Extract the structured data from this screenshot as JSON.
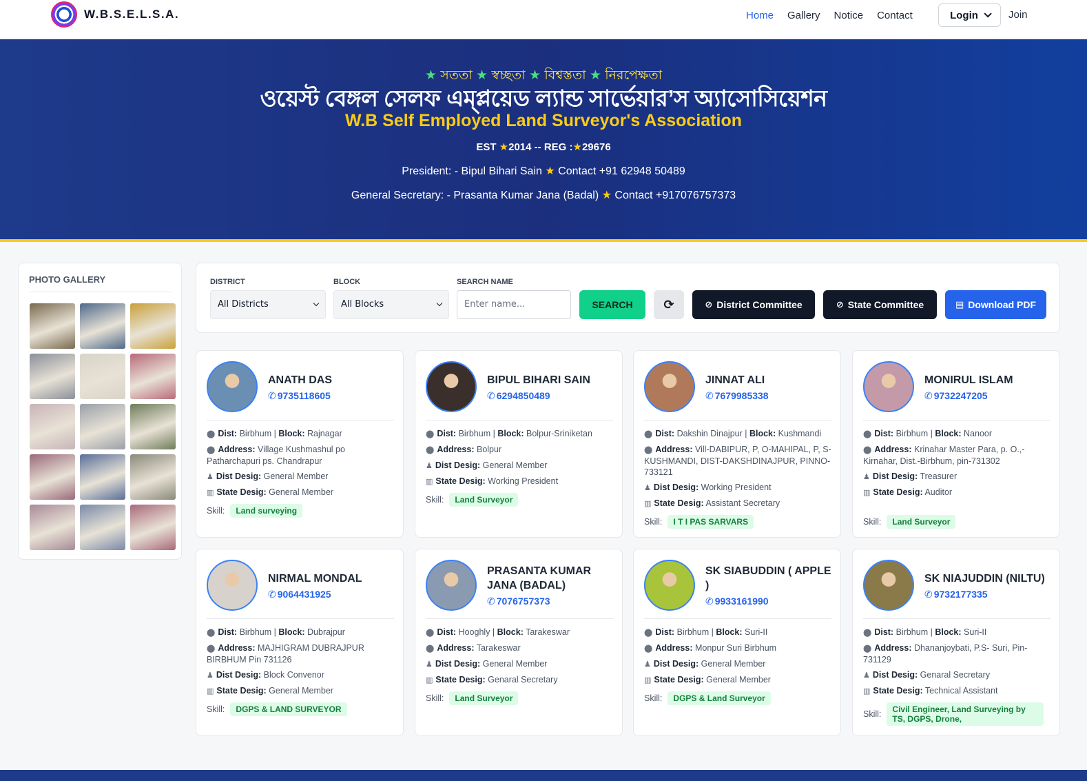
{
  "nav": {
    "brand": "W.B.S.E.L.S.A.",
    "links": [
      "Home",
      "Gallery",
      "Notice",
      "Contact"
    ],
    "login": "Login",
    "join": "Join"
  },
  "hero": {
    "motto_1": "সততা",
    "motto_2": "স্বচ্ছতা",
    "motto_3": "বিশ্বস্ততা",
    "motto_4": "নিরপেক্ষতা",
    "bn_title": "ওয়েস্ট বেঙ্গল সেলফ এম্প্লয়েড ল্যান্ড সার্ভেয়ার’স অ্যাসোসিয়েশন",
    "en_title": "W.B Self Employed Land Surveyor's Association",
    "est_label": "EST",
    "est_year": "2014",
    "reg_label": "-- REG :",
    "reg_no": "29676",
    "president": "President: - Bipul Bihari Sain",
    "president_contact": "Contact +91 62948 50489",
    "gen_sec": "General Secretary: - Prasanta Kumar Jana (Badal)",
    "gen_sec_contact": "Contact +917076757373"
  },
  "gallery": {
    "title": "PHOTO GALLERY",
    "thumb_colors": [
      "#7a6a4f",
      "#4f6a8a",
      "#c9a13a",
      "#8a8f99",
      "#d9d4c8",
      "#b86a7a",
      "#c8b4b8",
      "#9aa0a8",
      "#6f7d5a",
      "#9a6a7a",
      "#5a6f9a",
      "#8a8a7a",
      "#a88a98",
      "#7a8aa8",
      "#a86a7a"
    ]
  },
  "filters": {
    "district_label": "DISTRICT",
    "district_value": "All Districts",
    "block_label": "BLOCK",
    "block_value": "All Blocks",
    "search_label": "SEARCH NAME",
    "search_placeholder": "Enter name...",
    "search_btn": "SEARCH",
    "district_committee": "District Committee",
    "state_committee": "State Committee",
    "download_pdf": "Download PDF"
  },
  "labels": {
    "dist": "Dist:",
    "block": "Block:",
    "address": "Address:",
    "dist_desig": "Dist Desig:",
    "state_desig": "State Desig:",
    "skill": "Skill:"
  },
  "members": [
    {
      "name": "ANATH DAS",
      "phone": "9735118605",
      "dist": "Birbhum",
      "block": "Rajnagar",
      "address": "Village Kushmashul po Patharchapuri ps. Chandrapur",
      "dist_desig": "General Member",
      "state_desig": "General Member",
      "skill": "Land surveying",
      "avatar_color": "#6b8fb3"
    },
    {
      "name": "BIPUL BIHARI SAIN",
      "phone": "6294850489",
      "dist": "Birbhum",
      "block": "Bolpur-Sriniketan",
      "address": "Bolpur",
      "dist_desig": "General Member",
      "state_desig": "Working President",
      "skill": "Land Surveyor",
      "avatar_color": "#3a2f2a"
    },
    {
      "name": "JINNAT ALI",
      "phone": "7679985338",
      "dist": "Dakshin Dinajpur",
      "block": "Kushmandi",
      "address": "Vill-DABIPUR, P, O-MAHIPAL, P, S-KUSHMANDI, DIST-DAKSHDINAJPUR, PINNO-733121",
      "dist_desig": "Working President",
      "state_desig": "Assistant Secretary",
      "skill": "I T I PAS SARVARS",
      "avatar_color": "#b07a5a"
    },
    {
      "name": "MONIRUL ISLAM",
      "phone": "9732247205",
      "dist": "Birbhum",
      "block": "Nanoor",
      "address": "Krinahar Master Para, p. O.,- Kirnahar, Dist.-Birbhum, pin-731302",
      "dist_desig": "Treasurer",
      "state_desig": "Auditor",
      "skill": "Land Surveyor",
      "avatar_color": "#c49aa8"
    },
    {
      "name": "NIRMAL MONDAL",
      "phone": "9064431925",
      "dist": "Birbhum",
      "block": "Dubrajpur",
      "address": "MAJHIGRAM DUBRAJPUR BIRBHUM Pin 731126",
      "dist_desig": "Block Convenor",
      "state_desig": "General Member",
      "skill": "DGPS & LAND SURVEYOR",
      "avatar_color": "#d8d2cc"
    },
    {
      "name": "PRASANTA KUMAR JANA (BADAL)",
      "phone": "7076757373",
      "dist": "Hooghly",
      "block": "Tarakeswar",
      "address": "Tarakeswar",
      "dist_desig": "General Member",
      "state_desig": "Genaral Secretary",
      "skill": "Land Surveyor",
      "avatar_color": "#8a9ab0"
    },
    {
      "name": "SK SIABUDDIN ( APPLE )",
      "phone": "9933161990",
      "dist": "Birbhum",
      "block": "Suri-II",
      "address": "Monpur Suri Birbhum",
      "dist_desig": "General Member",
      "state_desig": "General Member",
      "skill": "DGPS & Land Surveyor",
      "avatar_color": "#a8c43a"
    },
    {
      "name": "SK NIAJUDDIN (NILTU)",
      "phone": "9732177335",
      "dist": "Birbhum",
      "block": "Suri-II",
      "address": "Dhananjoybati, P.S- Suri, Pin-731129",
      "dist_desig": "Genaral Secretary",
      "state_desig": "Technical Assistant",
      "skill": "Civil Engineer, Land Surveying by TS, DGPS, Drone,",
      "avatar_color": "#8a7a4a"
    }
  ]
}
